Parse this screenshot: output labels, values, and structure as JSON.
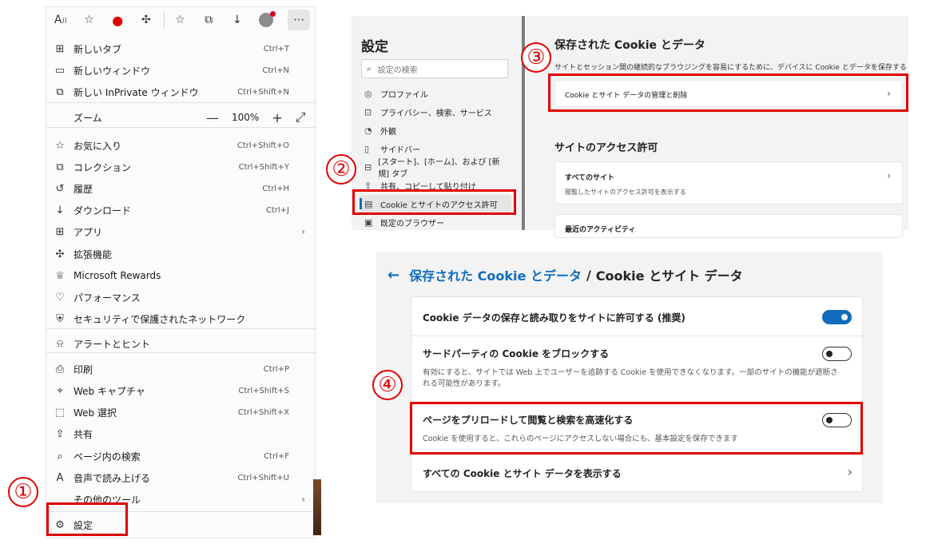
{
  "menu": {
    "zoom_label": "ズーム",
    "zoom_value": "100%",
    "items": [
      {
        "icon": "new-tab-icon",
        "glyph": "⊞",
        "label": "新しいタブ",
        "shortcut": "Ctrl+T"
      },
      {
        "icon": "new-window-icon",
        "glyph": "▭",
        "label": "新しいウィンドウ",
        "shortcut": "Ctrl+N"
      },
      {
        "icon": "inprivate-icon",
        "glyph": "⧉",
        "label": "新しい InPrivate ウィンドウ",
        "shortcut": "Ctrl+Shift+N"
      },
      {
        "icon": "favorites-icon",
        "glyph": "☆",
        "label": "お気に入り",
        "shortcut": "Ctrl+Shift+O"
      },
      {
        "icon": "collections-icon",
        "glyph": "⧉",
        "label": "コレクション",
        "shortcut": "Ctrl+Shift+Y"
      },
      {
        "icon": "history-icon",
        "glyph": "↺",
        "label": "履歴",
        "shortcut": "Ctrl+H"
      },
      {
        "icon": "download-icon",
        "glyph": "↓",
        "label": "ダウンロード",
        "shortcut": "Ctrl+J"
      },
      {
        "icon": "apps-icon",
        "glyph": "⊞",
        "label": "アプリ",
        "shortcut": ""
      },
      {
        "icon": "extensions-icon",
        "glyph": "✣",
        "label": "拡張機能",
        "shortcut": ""
      },
      {
        "icon": "rewards-icon",
        "glyph": "♕",
        "label": "Microsoft Rewards",
        "shortcut": ""
      },
      {
        "icon": "performance-icon",
        "glyph": "♡",
        "label": "パフォーマンス",
        "shortcut": ""
      },
      {
        "icon": "shield-icon",
        "glyph": "⛨",
        "label": "セキュリティで保護されたネットワーク",
        "shortcut": ""
      },
      {
        "icon": "bell-icon",
        "glyph": "⍾",
        "label": "アラートとヒント",
        "shortcut": ""
      },
      {
        "icon": "print-icon",
        "glyph": "⎙",
        "label": "印刷",
        "shortcut": "Ctrl+P"
      },
      {
        "icon": "web-capture-icon",
        "glyph": "⌖",
        "label": "Web キャプチャ",
        "shortcut": "Ctrl+Shift+S"
      },
      {
        "icon": "web-select-icon",
        "glyph": "⬚",
        "label": "Web 選択",
        "shortcut": "Ctrl+Shift+X"
      },
      {
        "icon": "share-icon",
        "glyph": "⇪",
        "label": "共有",
        "shortcut": ""
      },
      {
        "icon": "find-icon",
        "glyph": "⌕",
        "label": "ページ内の検索",
        "shortcut": "Ctrl+F"
      },
      {
        "icon": "read-aloud-icon",
        "glyph": "A",
        "label": "音声で読み上げる",
        "shortcut": "Ctrl+Shift+U"
      },
      {
        "icon": "more-tools-icon",
        "glyph": "",
        "label": "その他のツール",
        "shortcut": ""
      },
      {
        "icon": "gear-icon",
        "glyph": "⚙",
        "label": "設定",
        "shortcut": ""
      }
    ]
  },
  "settings": {
    "title": "設定",
    "search_placeholder": "設定の検索",
    "nav": [
      {
        "icon": "profile-icon",
        "glyph": "◎",
        "label": "プロファイル"
      },
      {
        "icon": "lock-icon",
        "glyph": "⊡",
        "label": "プライバシー、検索、サービス"
      },
      {
        "icon": "appearance-icon",
        "glyph": "◔",
        "label": "外観"
      },
      {
        "icon": "sidebar-icon",
        "glyph": "▯",
        "label": "サイドバー"
      },
      {
        "icon": "start-page-icon",
        "glyph": "⊟",
        "label": "[スタート]、[ホーム]、および [新規] タブ"
      },
      {
        "icon": "share-copy-icon",
        "glyph": "⇪",
        "label": "共有、コピーして貼り付け"
      },
      {
        "icon": "cookie-icon",
        "glyph": "▤",
        "label": "Cookie とサイトのアクセス許可"
      },
      {
        "icon": "default-browser-icon",
        "glyph": "▣",
        "label": "既定のブラウザー"
      }
    ]
  },
  "cookies": {
    "heading": "保存された Cookie とデータ",
    "description": "サイトとセッション間の継続的なブラウジングを容易にするために、デバイスに Cookie とデータを保存する",
    "manage_label": "Cookie とサイト データの管理と削除",
    "site_permissions_heading": "サイトのアクセス許可",
    "all_sites_label": "すべてのサイト",
    "all_sites_sub": "閲覧したサイトのアクセス許可を表示する",
    "recent_activity_label": "最近のアクティビティ"
  },
  "cookie_data": {
    "breadcrumb_link": "保存された Cookie とデータ",
    "breadcrumb_sep": "/",
    "breadcrumb_current": "Cookie とサイト データ",
    "allow_label": "Cookie データの保存と読み取りをサイトに許可する (推奨)",
    "allow_on": true,
    "block_third_party_label": "サードパーティの Cookie をブロックする",
    "block_third_party_sub": "有効にすると、サイトでは Web 上でユーザーを追跡する Cookie を使用できなくなります。一部のサイトの機能が遮断される可能性があります。",
    "block_third_party_on": false,
    "preload_label": "ページをプリロードして閲覧と検索を高速化する",
    "preload_sub": "Cookie を使用すると、これらのページにアクセスしない場合にも、基本設定を保存できます",
    "preload_on": false,
    "show_all_label": "すべての Cookie とサイト データを表示する"
  },
  "steps": [
    "①",
    "②",
    "③",
    "④"
  ],
  "colors": {
    "highlight": "#e00000",
    "accent": "#0f6cbd"
  }
}
